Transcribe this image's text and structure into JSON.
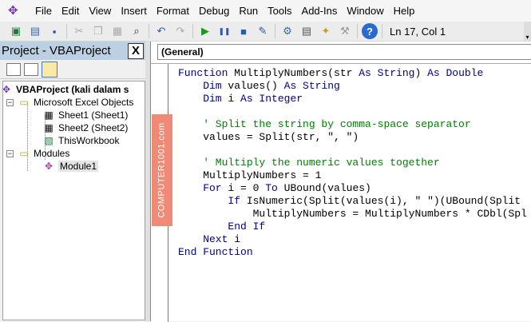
{
  "menu": [
    "File",
    "Edit",
    "View",
    "Insert",
    "Format",
    "Debug",
    "Run",
    "Tools",
    "Add-Ins",
    "Window",
    "Help"
  ],
  "toolbar": {
    "status": "Ln 17, Col 1",
    "icons": [
      "excel-icon",
      "insert-userform-icon",
      "save-icon",
      "cut-icon",
      "copy-icon",
      "paste-icon",
      "find-icon",
      "undo-icon",
      "redo-icon",
      "run-icon",
      "break-icon",
      "reset-icon",
      "design-mode-icon",
      "project-explorer-icon",
      "properties-icon",
      "object-browser-icon",
      "toolbox-icon",
      "help-icon"
    ]
  },
  "project": {
    "title": "Project - VBAProject",
    "close": "X",
    "tree": [
      {
        "label": "VBAProject (kali dalam s",
        "bold": true
      },
      {
        "label": "Microsoft Excel Objects"
      },
      {
        "label": "Sheet1 (Sheet1)"
      },
      {
        "label": "Sheet2 (Sheet2)"
      },
      {
        "label": "ThisWorkbook"
      },
      {
        "label": "Modules"
      },
      {
        "label": "Module1",
        "selected": true
      }
    ]
  },
  "code": {
    "object_combo": "(General)",
    "lines": [
      [
        [
          "kw",
          "Function "
        ],
        [
          "pl",
          "MultiplyNumbers(str "
        ],
        [
          "kw",
          "As String"
        ],
        [
          "pl",
          ") "
        ],
        [
          "kw",
          "As Double"
        ]
      ],
      [
        [
          "kw",
          "    Dim "
        ],
        [
          "pl",
          "values() "
        ],
        [
          "kw",
          "As String"
        ]
      ],
      [
        [
          "kw",
          "    Dim "
        ],
        [
          "pl",
          "i "
        ],
        [
          "kw",
          "As Integer"
        ]
      ],
      [],
      [
        [
          "cm",
          "    ' Split the string by comma-space separator"
        ]
      ],
      [
        [
          "pl",
          "    values = Split(str, \", \")"
        ]
      ],
      [],
      [
        [
          "cm",
          "    ' Multiply the numeric values together"
        ]
      ],
      [
        [
          "pl",
          "    MultiplyNumbers = 1"
        ]
      ],
      [
        [
          "kw",
          "    For "
        ],
        [
          "pl",
          "i = 0 "
        ],
        [
          "kw",
          "To "
        ],
        [
          "pl",
          "UBound(values)"
        ]
      ],
      [
        [
          "kw",
          "        If "
        ],
        [
          "pl",
          "IsNumeric(Split(values(i), \" \")(UBound(Split"
        ]
      ],
      [
        [
          "pl",
          "            MultiplyNumbers = MultiplyNumbers * CDbl(Spl"
        ]
      ],
      [
        [
          "kw",
          "        End If"
        ]
      ],
      [
        [
          "kw",
          "    Next "
        ],
        [
          "pl",
          "i"
        ]
      ],
      [
        [
          "kw",
          "End Function"
        ]
      ]
    ]
  },
  "watermark": "COMPUTER1001.com",
  "colors": {
    "keyword": "#00008b",
    "comment": "#008000",
    "title_bar": "#bcd0e4",
    "watermark": "#ef8a76"
  }
}
